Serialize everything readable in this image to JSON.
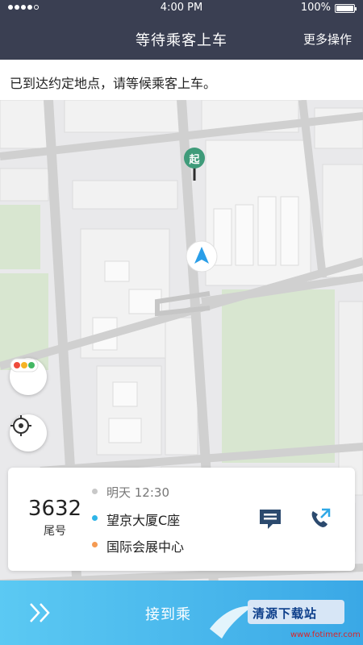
{
  "status": {
    "time": "4:00 PM",
    "battery": "100%"
  },
  "header": {
    "title": "等待乘客上车",
    "more": "更多操作"
  },
  "notice": "已到达约定地点，请等候乘客上车。",
  "map": {
    "start_marker": "起"
  },
  "order": {
    "plate": "3632",
    "plate_label": "尾号",
    "time": "明天 12:30",
    "pickup": "望京大厦C座",
    "dropoff": "国际会展中心"
  },
  "action": {
    "label": "接到乘"
  },
  "watermark": {
    "text": "清源下载站",
    "sub": "www.fotimer.com"
  },
  "colors": {
    "header": "#3a3f52",
    "accent": "#5bc9f3",
    "pickup_dot": "#2fb5e8",
    "dropoff_dot": "#f59a52",
    "start_marker": "#3f9b7a"
  }
}
